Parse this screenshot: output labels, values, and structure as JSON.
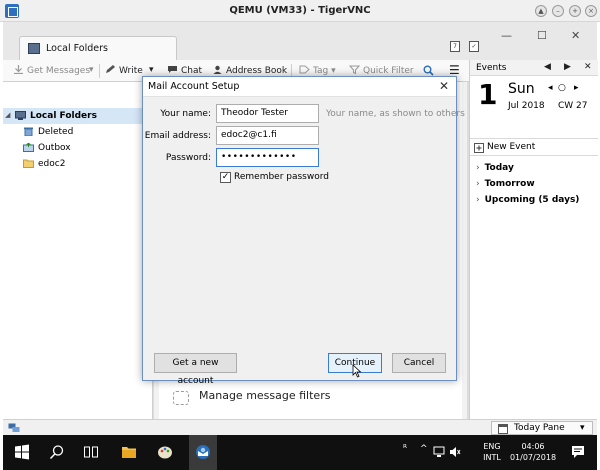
{
  "vnc": {
    "title": "QEMU (VM33) - TigerVNC"
  },
  "tabs": [
    {
      "label": "Local Folders"
    }
  ],
  "toolbar": {
    "get_messages": "Get Messages",
    "write": "Write",
    "chat": "Chat",
    "address_book": "Address Book",
    "tag": "Tag",
    "quick_filter": "Quick Filter"
  },
  "folders": [
    {
      "label": "Local Folders"
    },
    {
      "label": "Deleted"
    },
    {
      "label": "Outbox"
    },
    {
      "label": "edoc2"
    }
  ],
  "center": {
    "manage_filters": "Manage message filters"
  },
  "today_pane": {
    "title": "Events",
    "day_number": "1",
    "day_name": "Sun",
    "month_year": "Jul 2018",
    "week": "CW 27",
    "new_event": "New Event",
    "groups": [
      {
        "label": "Today"
      },
      {
        "label": "Tomorrow"
      },
      {
        "label": "Upcoming (5 days)"
      }
    ]
  },
  "status": {
    "today_pane_label": "Today Pane"
  },
  "dialog": {
    "title": "Mail Account Setup",
    "name_label": "Your name:",
    "name_value": "Theodor Tester",
    "name_hint": "Your name, as shown to others",
    "email_label": "Email address:",
    "email_value": "edoc2@c1.fi",
    "password_label": "Password:",
    "password_value": "•••••••••••••",
    "remember_label": "Remember password",
    "remember_checked": true,
    "get_new_account": "Get a new account",
    "continue": "Continue",
    "cancel": "Cancel"
  },
  "taskbar": {
    "language": "ENG",
    "layout": "INTL",
    "time": "04:06",
    "date": "01/07/2018"
  },
  "colors": {
    "accent": "#3a7bd5",
    "selection": "#d5e6f7",
    "taskbar": "#101010"
  }
}
